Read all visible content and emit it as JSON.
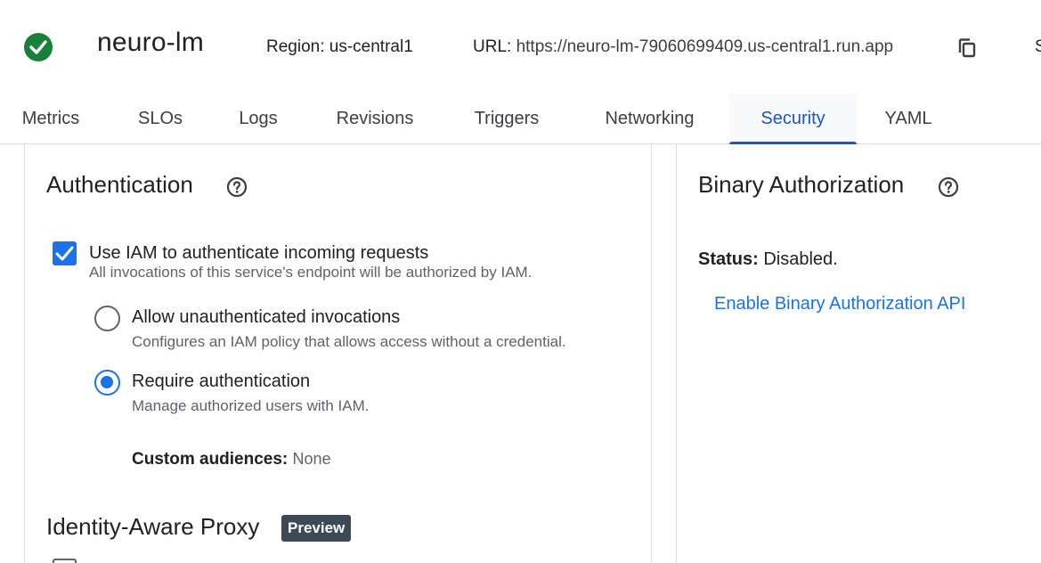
{
  "header": {
    "service_name": "neuro-lm",
    "region_label": "Region:",
    "region_value": "us-central1",
    "url_label": "URL:",
    "url_value": "https://neuro-lm-79060699409.us-central1.run.app",
    "edge_text": "S",
    "status_icon": "check-circle-icon",
    "status_color": "#188038"
  },
  "tabs": [
    {
      "label": "Metrics"
    },
    {
      "label": "SLOs"
    },
    {
      "label": "Logs"
    },
    {
      "label": "Revisions"
    },
    {
      "label": "Triggers"
    },
    {
      "label": "Networking"
    },
    {
      "label": "Security",
      "active": true
    },
    {
      "label": "YAML"
    }
  ],
  "authentication": {
    "title": "Authentication",
    "use_iam": {
      "checked": true,
      "label": "Use IAM to authenticate incoming requests",
      "description": "All invocations of this service's endpoint will be authorized by IAM."
    },
    "options": [
      {
        "label": "Allow unauthenticated invocations",
        "description": "Configures an IAM policy that allows access without a credential.",
        "selected": false
      },
      {
        "label": "Require authentication",
        "description": "Manage authorized users with IAM.",
        "selected": true
      }
    ],
    "custom_audiences_label": "Custom audiences:",
    "custom_audiences_value": "None"
  },
  "iap": {
    "title": "Identity-Aware Proxy",
    "badge": "Preview"
  },
  "binary_authorization": {
    "title": "Binary Authorization",
    "status_label": "Status:",
    "status_value": "Disabled.",
    "enable_link": "Enable Binary Authorization API"
  },
  "colors": {
    "accent": "#1a73e8",
    "tab_active": "#1a56c4",
    "badge_bg": "#3c4a56"
  }
}
